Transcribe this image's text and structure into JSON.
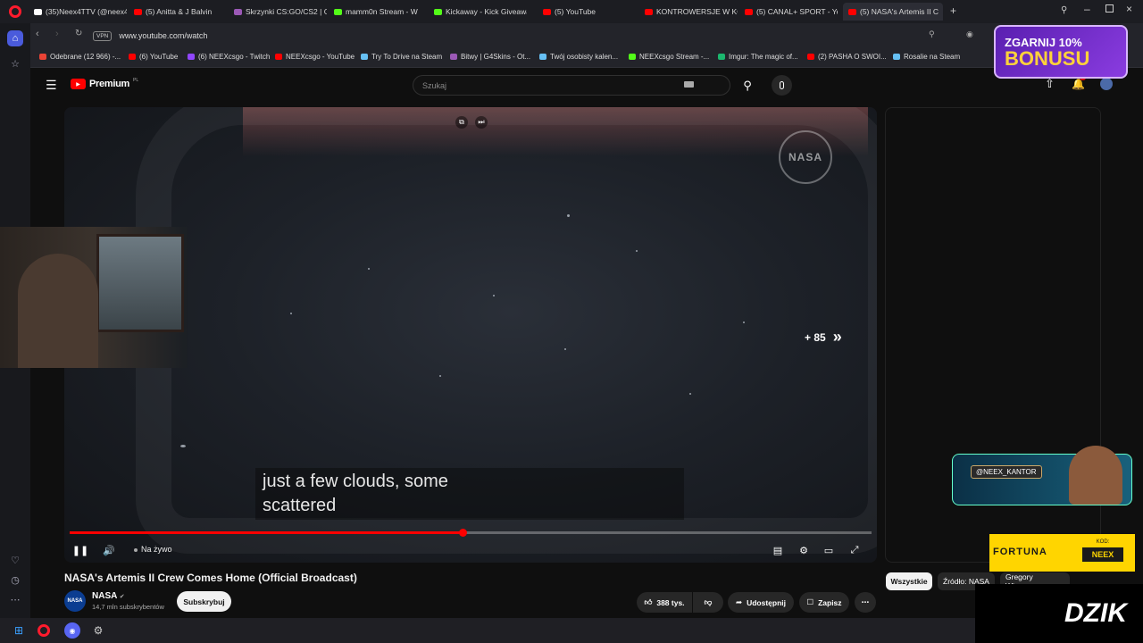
{
  "browser": {
    "tabs": [
      {
        "label": "(35)Neex4TTV (@neex4tt",
        "color": "#ffffff"
      },
      {
        "label": "(5) Anitta & J Balvin",
        "color": "#ff0000"
      },
      {
        "label": "Skrzynki CS:GO/CS2 | G4S",
        "color": "#9b59b6"
      },
      {
        "label": "mamm0n Stream - W",
        "color": "#53fc18"
      },
      {
        "label": "Kickaway - Kick Giveaway",
        "color": "#53fc18"
      },
      {
        "label": "(5) YouTube",
        "color": "#ff0000"
      },
      {
        "label": "KONTROWERSJE W KOŃC",
        "color": "#ff0000"
      },
      {
        "label": "(5) CANAL+ SPORT - You",
        "color": "#ff0000"
      },
      {
        "label": "(5) NASA's Artemis II C",
        "color": "#ff0000"
      }
    ],
    "url": "www.youtube.com/watch",
    "vpn_label": "VPN",
    "bookmarks": [
      {
        "label": "Odebrane (12 966) -...",
        "color": "#ea4335"
      },
      {
        "label": "(6) YouTube",
        "color": "#ff0000"
      },
      {
        "label": "(6) NEEXcsgo - Twitch",
        "color": "#9146ff"
      },
      {
        "label": "NEEXcsgo - YouTube",
        "color": "#ff0000"
      },
      {
        "label": "Try To Drive na Steam",
        "color": "#66c0f4"
      },
      {
        "label": "Bitwy | G4Skins - Ot...",
        "color": "#9b59b6"
      },
      {
        "label": "Twój osobisty kalen...",
        "color": "#66c0f4"
      },
      {
        "label": "NEEXcsgo Stream -...",
        "color": "#53fc18"
      },
      {
        "label": "Imgur: The magic of...",
        "color": "#1bb76e"
      },
      {
        "label": "(2) PASHA O SWOI...",
        "color": "#ff0000"
      },
      {
        "label": "Rosalie na Steam",
        "color": "#66c0f4"
      }
    ]
  },
  "youtube": {
    "logo_text": "Premium",
    "logo_region": "PL",
    "search_placeholder": "Szukaj",
    "notification_count": "5"
  },
  "player": {
    "top_icons": [
      "playlist-icon",
      "autoplay-icon"
    ],
    "watermark": "NASA",
    "skip_label": "+ 85",
    "caption_line1": "just a few clouds, some",
    "caption_line2": "scattered",
    "progress_fraction": 0.49,
    "live_label": "Na żywo"
  },
  "video_info": {
    "title": "NASA's Artemis II Crew Comes Home (Official Broadcast)",
    "channel": "NASA",
    "subscribers": "14,7 mln subskrybentów",
    "subscribe_label": "Subskrybuj",
    "likes": "388 tys.",
    "share_label": "Udostępnij",
    "save_label": "Zapisz",
    "channel_avatar_text": "NASA"
  },
  "chips": [
    "Wszystkie",
    "Źródło: NASA",
    "Gregory Wiseman"
  ],
  "overlays": {
    "bonus_line1": "ZGARNIJ 10%",
    "bonus_line2": "BONUSU",
    "kantor_handle": "@NEEX_KANTOR",
    "fortuna_name": "FORTUNA",
    "fortuna_kod_label": "KOD:",
    "fortuna_code": "NEEX",
    "dzik_text": "DZIK"
  }
}
